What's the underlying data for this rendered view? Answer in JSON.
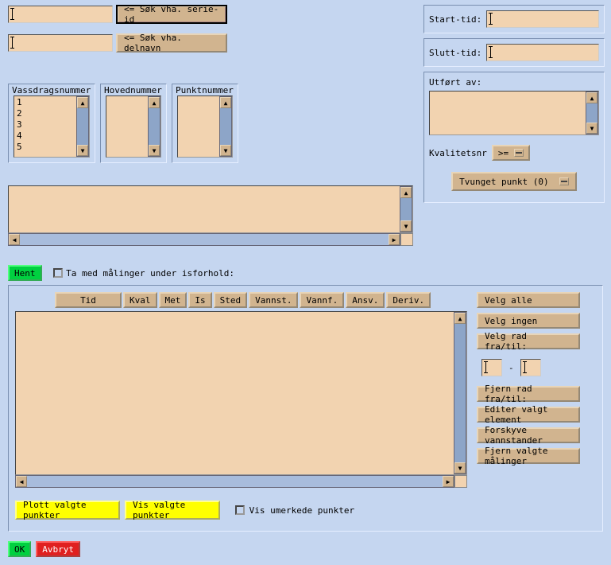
{
  "top": {
    "serie_id_value": "",
    "serie_id_btn": "<= Søk vha. serie-id",
    "delnavn_value": "",
    "delnavn_btn": "<= Søk vha. delnavn"
  },
  "lists": {
    "vassdrag_label": "Vassdragsnummer",
    "hoved_label": "Hovednummer",
    "punkt_label": "Punktnummer",
    "vassdrag_items": [
      "1",
      "2",
      "3",
      "4",
      "5"
    ]
  },
  "right": {
    "start_label": "Start-tid:",
    "start_value": "",
    "slutt_label": "Slutt-tid:",
    "slutt_value": "",
    "utfort_label": "Utført av:",
    "kvalitet_label": "Kvalitetsnr",
    "kvalitet_op": ">=",
    "tvunget_label": "Tvunget punkt (0)"
  },
  "hent": {
    "btn": "Hent",
    "check_label": "Ta med målinger under isforhold:"
  },
  "cols": {
    "tid": "Tid",
    "kval": "Kval",
    "met": "Met",
    "is": "Is",
    "sted": "Sted",
    "vannst": "Vannst.",
    "vannf": "Vannf.",
    "ansv": "Ansv.",
    "deriv": "Deriv."
  },
  "side": {
    "velg_alle": "Velg alle",
    "velg_ingen": "Velg ingen",
    "velg_rad": "Velg rad fra/til:",
    "dash": "-",
    "fjern_rad": "Fjern rad fra/til:",
    "editer": "Editer valgt element",
    "forskyve": "Forskyve vannstander",
    "fjern_valgte": "Fjern valgte målinger"
  },
  "actions": {
    "plott": "Plott valgte punkter",
    "vis": "Vis valgte punkter",
    "vis_umerkede": "Vis umerkede punkter"
  },
  "bottom": {
    "ok": "OK",
    "avbryt": "Avbryt"
  }
}
